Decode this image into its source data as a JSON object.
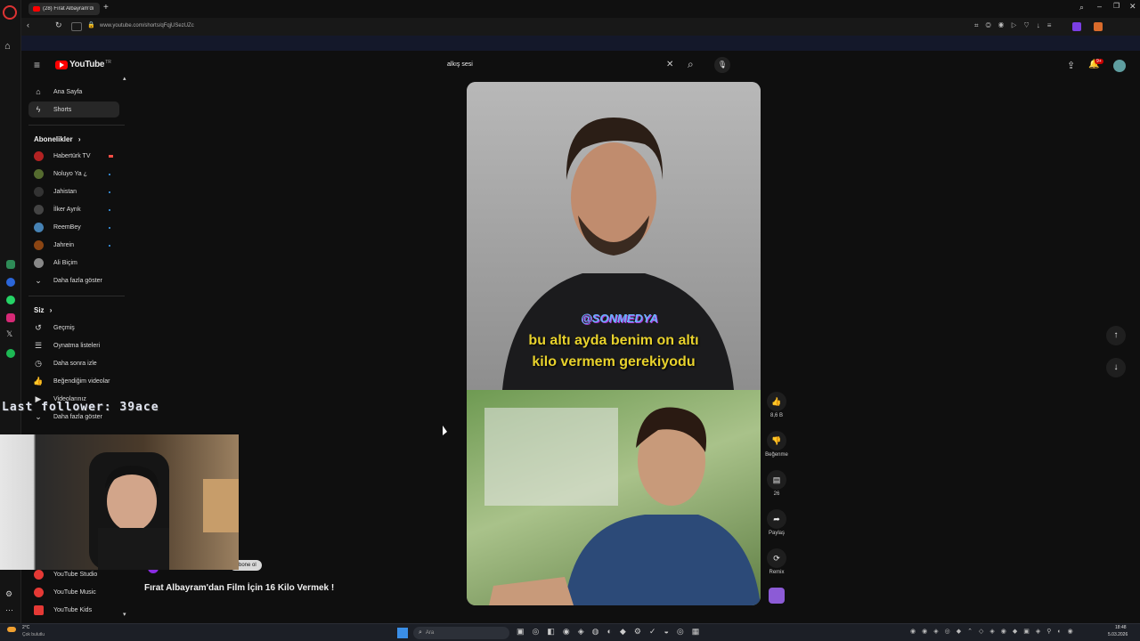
{
  "browser": {
    "tab_title": "(28) Fırat Albayram'dı",
    "url": "www.youtube.com/shorts/qFqjUSezUZc",
    "new_tab": "+"
  },
  "youtube": {
    "logo_text": "YouTube",
    "country": "TR",
    "search_value": "alkış sesi",
    "notif_badge": "9+",
    "nav": {
      "home": "Ana Sayfa",
      "shorts": "Shorts",
      "subs_header": "Abonelikler",
      "subs": [
        "Habertürk TV",
        "Noluyo Ya ¿",
        "Jahistan",
        "İlker Ayrık",
        "ReemBey",
        "Jahrein",
        "Ali Biçim"
      ],
      "more": "Daha fazla göster",
      "you_header": "Siz",
      "history": "Geçmiş",
      "playlists": "Oynatma listeleri",
      "watch_later": "Daha sonra izle",
      "liked": "Beğendiğim videolar",
      "your_videos": "Videolarınız",
      "more2": "Daha fazla göster",
      "studio": "YouTube Studio",
      "music": "YouTube Music",
      "kids": "YouTube Kids"
    },
    "video": {
      "watermark": "@SONMEDYA",
      "caption_line1": "bu altı ayda benim on altı",
      "caption_line2": "kilo vermem gerekiyodu",
      "title": "Fırat Albayram'dan Film İçin 16 Kilo Vermek !",
      "subscribe": "Abone ol"
    },
    "actions": {
      "likes": "8,6 B",
      "dislike": "Beğenme",
      "comments": "26",
      "share": "Paylaş",
      "remix": "Remix"
    }
  },
  "stream": {
    "last_follower": "Last follower: 39ace"
  },
  "taskbar": {
    "weather_temp": "2°C",
    "weather_text": "Çok bulutlu",
    "search_placeholder": "Ara",
    "time": "18:48",
    "date": "5.03.2026"
  },
  "colors": {
    "yt_red": "#ff0000",
    "caption_yellow": "#e8d22c",
    "watermark_blue": "#6ab4ff",
    "follower_text": "#dfe3ee"
  }
}
